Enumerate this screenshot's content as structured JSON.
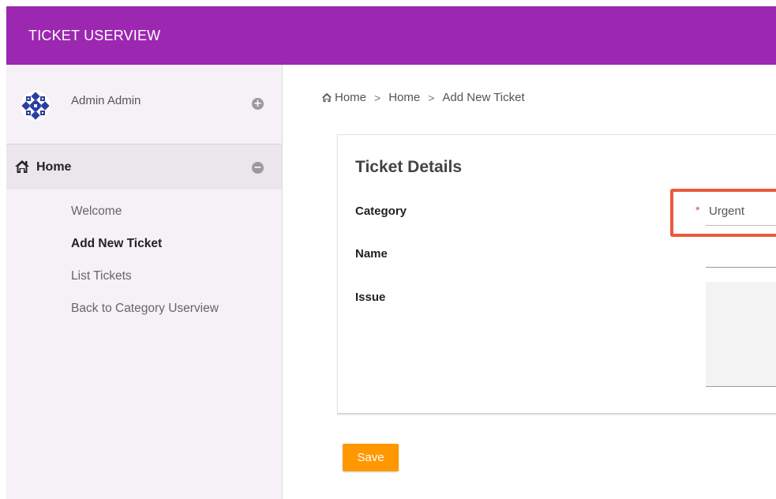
{
  "app": {
    "title": "TICKET USERVIEW"
  },
  "colors": {
    "brand": "#9c27b0",
    "save": "#ff9800",
    "highlight": "#ea5a3c",
    "required": "#e0453a"
  },
  "sidebar": {
    "user": {
      "name": "Admin Admin",
      "expand_icon": "plus-circle-icon"
    },
    "home": {
      "label": "Home",
      "icon": "home-icon",
      "collapse_icon": "minus-circle-icon"
    },
    "items": [
      {
        "label": "Welcome",
        "active": false
      },
      {
        "label": "Add New Ticket",
        "active": true
      },
      {
        "label": "List Tickets",
        "active": false
      },
      {
        "label": "Back to Category Userview",
        "active": false
      }
    ]
  },
  "breadcrumb": {
    "icon": "home-icon",
    "items": [
      "Home",
      "Home",
      "Add New Ticket"
    ],
    "separator": ">"
  },
  "form": {
    "title": "Ticket Details",
    "fields": {
      "category": {
        "label": "Category",
        "value": "Urgent",
        "required": true,
        "required_mark": "*"
      },
      "name": {
        "label": "Name",
        "value": ""
      },
      "issue": {
        "label": "Issue",
        "value": ""
      }
    },
    "save_label": "Save"
  }
}
